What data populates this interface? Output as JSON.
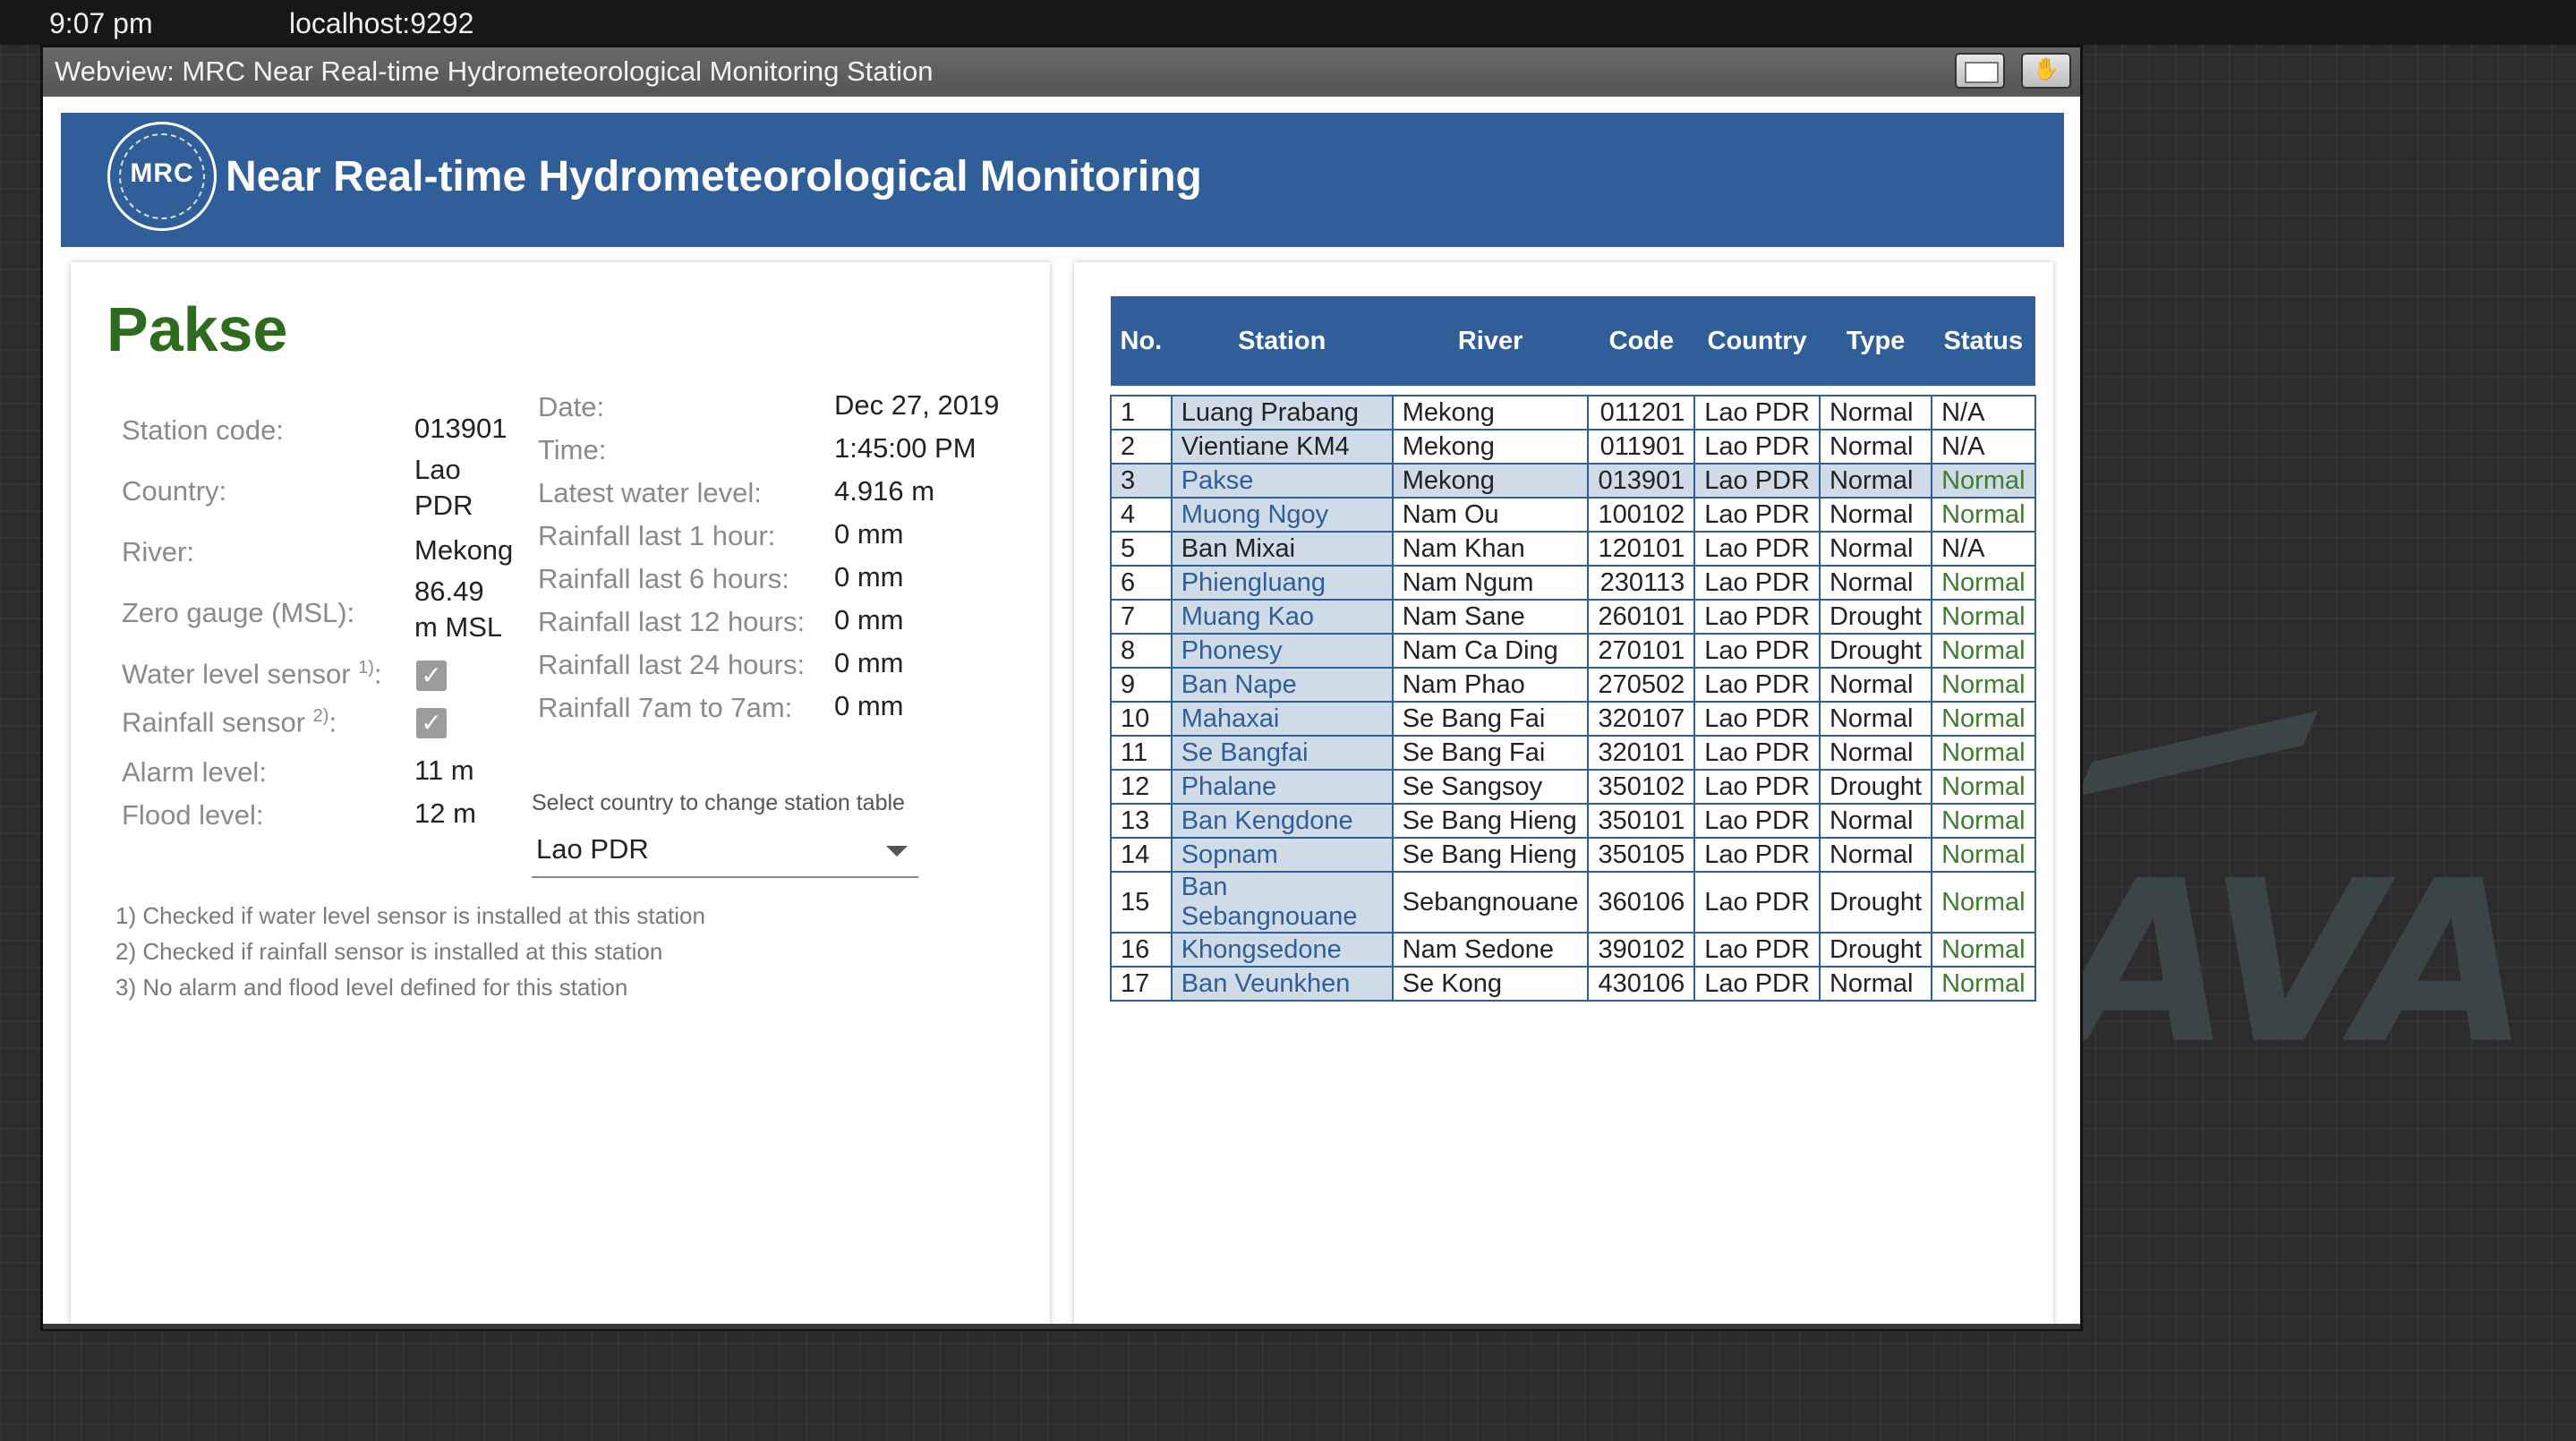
{
  "system": {
    "time": "9:07 pm",
    "host": "localhost:9292"
  },
  "window": {
    "title": "Webview: MRC Near Real-time Hydrometeorological Monitoring Station"
  },
  "header": {
    "logo_text": "MRC",
    "title": "Near Real-time Hydrometeorological Monitoring"
  },
  "station": {
    "name": "Pakse",
    "labels": {
      "code": "Station code:",
      "country": "Country:",
      "river": "River:",
      "zero_gauge": "Zero gauge (MSL):",
      "water_sensor": "Water level sensor",
      "water_sensor_sup": "1)",
      "rain_sensor": "Rainfall sensor",
      "rain_sensor_sup": "2)",
      "colon": ":",
      "alarm": "Alarm level:",
      "flood": "Flood level:",
      "date": "Date:",
      "time": "Time:",
      "latest": "Latest water level:",
      "r1": "Rainfall last 1 hour:",
      "r6": "Rainfall last 6 hours:",
      "r12": "Rainfall last 12 hours:",
      "r24": "Rainfall last 24 hours:",
      "r77": "Rainfall 7am to 7am:"
    },
    "values": {
      "code": "013901",
      "country_line1": "Lao",
      "country_line2": "PDR",
      "river": "Mekong",
      "zero_line1": "86.49",
      "zero_line2": "m MSL",
      "water_sensor": true,
      "rain_sensor": true,
      "alarm": "11 m",
      "flood": "12 m",
      "date": "Dec 27, 2019",
      "time": "1:45:00 PM",
      "latest": "4.916 m",
      "r1": "0 mm",
      "r6": "0 mm",
      "r12": "0 mm",
      "r24": "0 mm",
      "r77": "0 mm"
    },
    "check_glyph": "✓"
  },
  "country_select": {
    "label": "Select country to change station table",
    "value": "Lao PDR"
  },
  "notes": [
    "1) Checked if water level sensor is installed at this station",
    "2) Checked if rainfall sensor is installed at this station",
    "3) No alarm and flood level defined for this station"
  ],
  "table": {
    "headers": [
      "No.",
      "Station",
      "River",
      "Code",
      "Country",
      "Type",
      "Status"
    ],
    "rows": [
      {
        "no": "1",
        "station": "Luang Prabang",
        "river": "Mekong",
        "code": "011201",
        "country": "Lao PDR",
        "type": "Normal",
        "status": "N/A"
      },
      {
        "no": "2",
        "station": "Vientiane KM4",
        "river": "Mekong",
        "code": "011901",
        "country": "Lao PDR",
        "type": "Normal",
        "status": "N/A"
      },
      {
        "no": "3",
        "station": "Pakse",
        "river": "Mekong",
        "code": "013901",
        "country": "Lao PDR",
        "type": "Normal",
        "status": "Normal"
      },
      {
        "no": "4",
        "station": "Muong Ngoy",
        "river": "Nam Ou",
        "code": "100102",
        "country": "Lao PDR",
        "type": "Normal",
        "status": "Normal"
      },
      {
        "no": "5",
        "station": "Ban Mixai",
        "river": "Nam Khan",
        "code": "120101",
        "country": "Lao PDR",
        "type": "Normal",
        "status": "N/A"
      },
      {
        "no": "6",
        "station": "Phiengluang",
        "river": "Nam Ngum",
        "code": "230113",
        "country": "Lao PDR",
        "type": "Normal",
        "status": "Normal"
      },
      {
        "no": "7",
        "station": "Muang Kao",
        "river": "Nam Sane",
        "code": "260101",
        "country": "Lao PDR",
        "type": "Drought",
        "status": "Normal"
      },
      {
        "no": "8",
        "station": "Phonesy",
        "river": "Nam Ca Ding",
        "code": "270101",
        "country": "Lao PDR",
        "type": "Drought",
        "status": "Normal"
      },
      {
        "no": "9",
        "station": "Ban Nape",
        "river": "Nam Phao",
        "code": "270502",
        "country": "Lao PDR",
        "type": "Normal",
        "status": "Normal"
      },
      {
        "no": "10",
        "station": "Mahaxai",
        "river": "Se Bang Fai",
        "code": "320107",
        "country": "Lao PDR",
        "type": "Normal",
        "status": "Normal"
      },
      {
        "no": "11",
        "station": "Se Bangfai",
        "river": "Se Bang Fai",
        "code": "320101",
        "country": "Lao PDR",
        "type": "Normal",
        "status": "Normal"
      },
      {
        "no": "12",
        "station": "Phalane",
        "river": "Se Sangsoy",
        "code": "350102",
        "country": "Lao PDR",
        "type": "Drought",
        "status": "Normal"
      },
      {
        "no": "13",
        "station": "Ban Kengdone",
        "river": "Se Bang Hieng",
        "code": "350101",
        "country": "Lao PDR",
        "type": "Normal",
        "status": "Normal"
      },
      {
        "no": "14",
        "station": "Sopnam",
        "river": "Se Bang Hieng",
        "code": "350105",
        "country": "Lao PDR",
        "type": "Normal",
        "status": "Normal"
      },
      {
        "no": "15",
        "station": "Ban Sebangnouane",
        "river": "Sebangnouane",
        "code": "360106",
        "country": "Lao PDR",
        "type": "Drought",
        "status": "Normal"
      },
      {
        "no": "16",
        "station": "Khongsedone",
        "river": "Nam Sedone",
        "code": "390102",
        "country": "Lao PDR",
        "type": "Drought",
        "status": "Normal"
      },
      {
        "no": "17",
        "station": "Ban Veunkhen",
        "river": "Se Kong",
        "code": "430106",
        "country": "Lao PDR",
        "type": "Normal",
        "status": "Normal"
      }
    ],
    "linked_stations": [
      "Pakse",
      "Muong Ngoy",
      "Phiengluang",
      "Muang Kao",
      "Phonesy",
      "Ban Nape",
      "Mahaxai",
      "Se Bangfai",
      "Phalane",
      "Ban Kengdone",
      "Sopnam",
      "Ban Sebangnouane",
      "Khongsedone",
      "Ban Veunkhen"
    ],
    "selected_station": "Pakse"
  },
  "colors": {
    "header_blue": "#2f5e98",
    "title_green": "#2e6b1e",
    "status_green": "#3e7d2c",
    "row_highlight": "#cfdbe6"
  },
  "background_logo": "AVA"
}
